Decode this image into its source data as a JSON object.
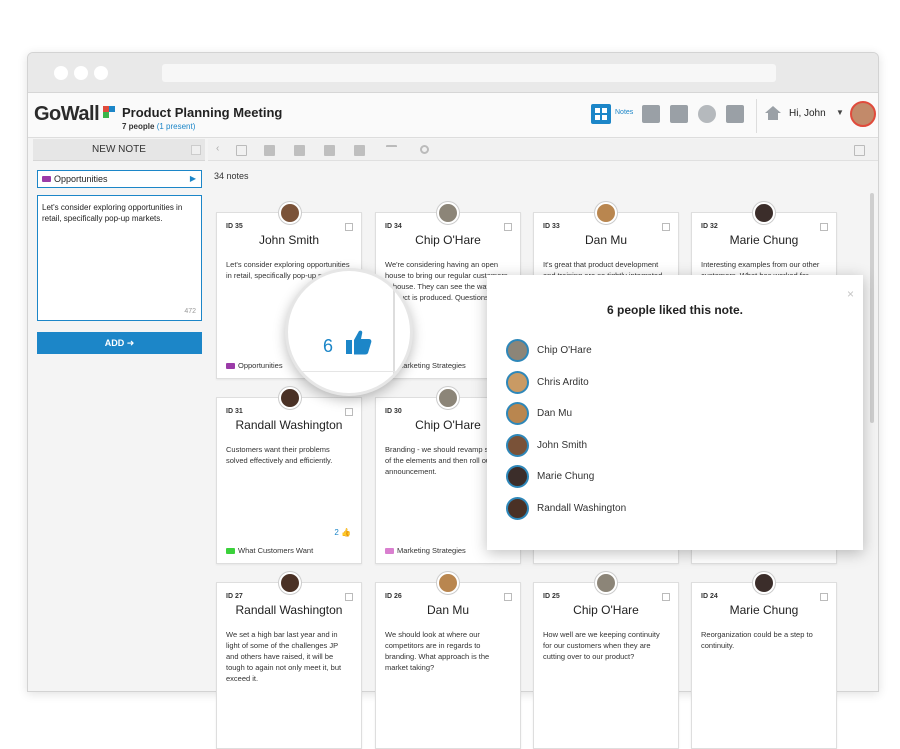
{
  "app": {
    "logo": "GoWall",
    "meeting_title": "Product Planning Meeting",
    "people": "7 people",
    "present": "(1 present)",
    "notes_label": "Notes",
    "greeting": "Hi, John"
  },
  "sidebar": {
    "header": "NEW NOTE",
    "category": "Opportunities",
    "note_text": "Let's consider exploring opportunities in retail, specifically pop-up markets.",
    "char_count": "472",
    "add_label": "ADD ➜"
  },
  "board": {
    "count": "34 notes",
    "cards": [
      {
        "id": "ID 35",
        "name": "John Smith",
        "text": "Let's consider exploring opportunities in retail, specifically pop-up markets.",
        "tag": "Opportunities",
        "tag_color": "#9b3ba8",
        "likes": ""
      },
      {
        "id": "ID 34",
        "name": "Chip O'Hare",
        "text": "We're considering having an open house to bring our regular customers in house. They can see the way the product is produced. Questions.",
        "tag": "Marketing Strategies",
        "tag_color": "#d97fcf",
        "likes": ""
      },
      {
        "id": "ID 33",
        "name": "Dan Mu",
        "text": "It's great that product development and training are so tightly integrated.",
        "tag": "",
        "tag_color": "#3bb54a",
        "likes": ""
      },
      {
        "id": "ID 32",
        "name": "Marie Chung",
        "text": "Interesting examples from our other customers. What has worked for",
        "tag": "",
        "tag_color": "#d9443a",
        "likes": ""
      },
      {
        "id": "ID 31",
        "name": "Randall Washington",
        "text": "Customers want their problems solved effectively and efficiently.",
        "tag": "What Customers Want",
        "tag_color": "#3bd13b",
        "likes": "2"
      },
      {
        "id": "ID 30",
        "name": "Chip O'Hare",
        "text": "Branding - we should revamp some of the elements and then roll out an announcement.",
        "tag": "Marketing Strategies",
        "tag_color": "#d97fcf",
        "likes": ""
      },
      {
        "id": "ID 27",
        "name": "Randall Washington",
        "text": "We set a high bar last year and in light of some of the challenges JP and others have raised, it will be tough to again not only meet it, but exceed it.",
        "tag": "",
        "tag_color": "#3bb54a",
        "likes": ""
      },
      {
        "id": "ID 26",
        "name": "Dan Mu",
        "text": "We should look at where our competitors are in regards to branding. What approach is the market taking?",
        "tag": "",
        "tag_color": "#d97fcf",
        "likes": ""
      },
      {
        "id": "ID 25",
        "name": "Chip O'Hare",
        "text": "How well are we keeping continuity for our customers when they are cutting over to our product?",
        "tag": "",
        "tag_color": "#3bb54a",
        "likes": ""
      },
      {
        "id": "ID 24",
        "name": "Marie Chung",
        "text": "Reorganization could be a step to continuity.",
        "tag": "",
        "tag_color": "#d9443a",
        "likes": ""
      }
    ]
  },
  "magnifier": {
    "likes": "6"
  },
  "popup": {
    "title": "6 people liked this note.",
    "close": "×",
    "likers": [
      "Chip O'Hare",
      "Chris Ardito",
      "Dan Mu",
      "John Smith",
      "Marie Chung",
      "Randall Washington"
    ]
  }
}
